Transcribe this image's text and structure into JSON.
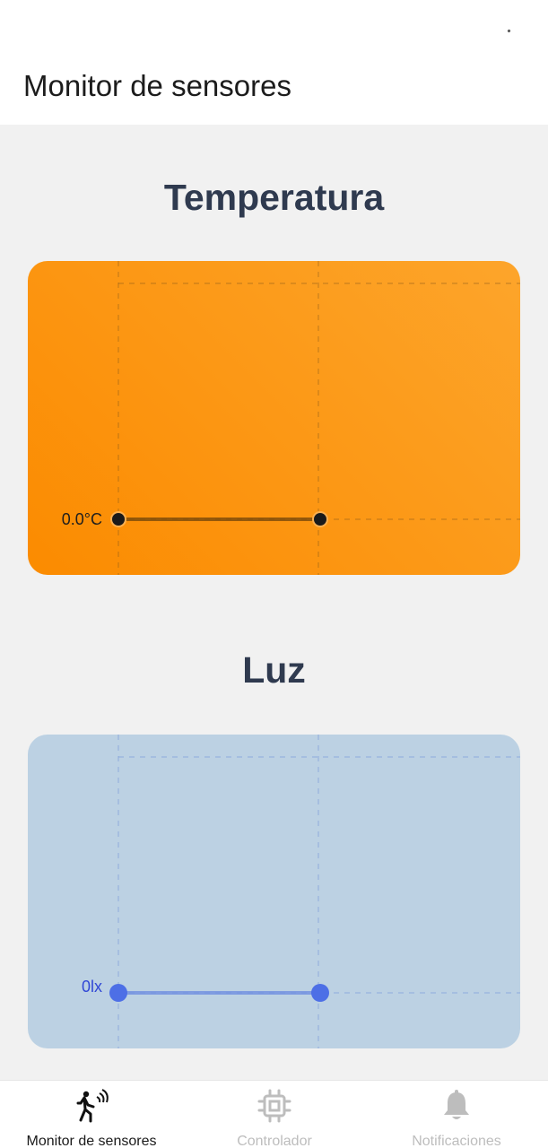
{
  "app": {
    "title": "Monitor de sensores"
  },
  "sections": [
    {
      "title": "Temperatura",
      "value_label": "0.0°C",
      "value": 0.0,
      "colors": {
        "card": "#fb8b00",
        "line": "#7a4a0a",
        "point": "#1a1a1a"
      }
    },
    {
      "title": "Luz",
      "value_label": "0lx",
      "value": 0,
      "colors": {
        "card": "#bcd1e3",
        "line": "#6f8fe0",
        "point": "#4d6fe6"
      }
    }
  ],
  "bottom_nav": {
    "items": [
      {
        "label": "Monitor de sensores",
        "icon": "motion-sensor-icon",
        "active": true
      },
      {
        "label": "Controlador",
        "icon": "chip-icon",
        "active": false
      },
      {
        "label": "Notificaciones",
        "icon": "bell-icon",
        "active": false
      }
    ]
  }
}
